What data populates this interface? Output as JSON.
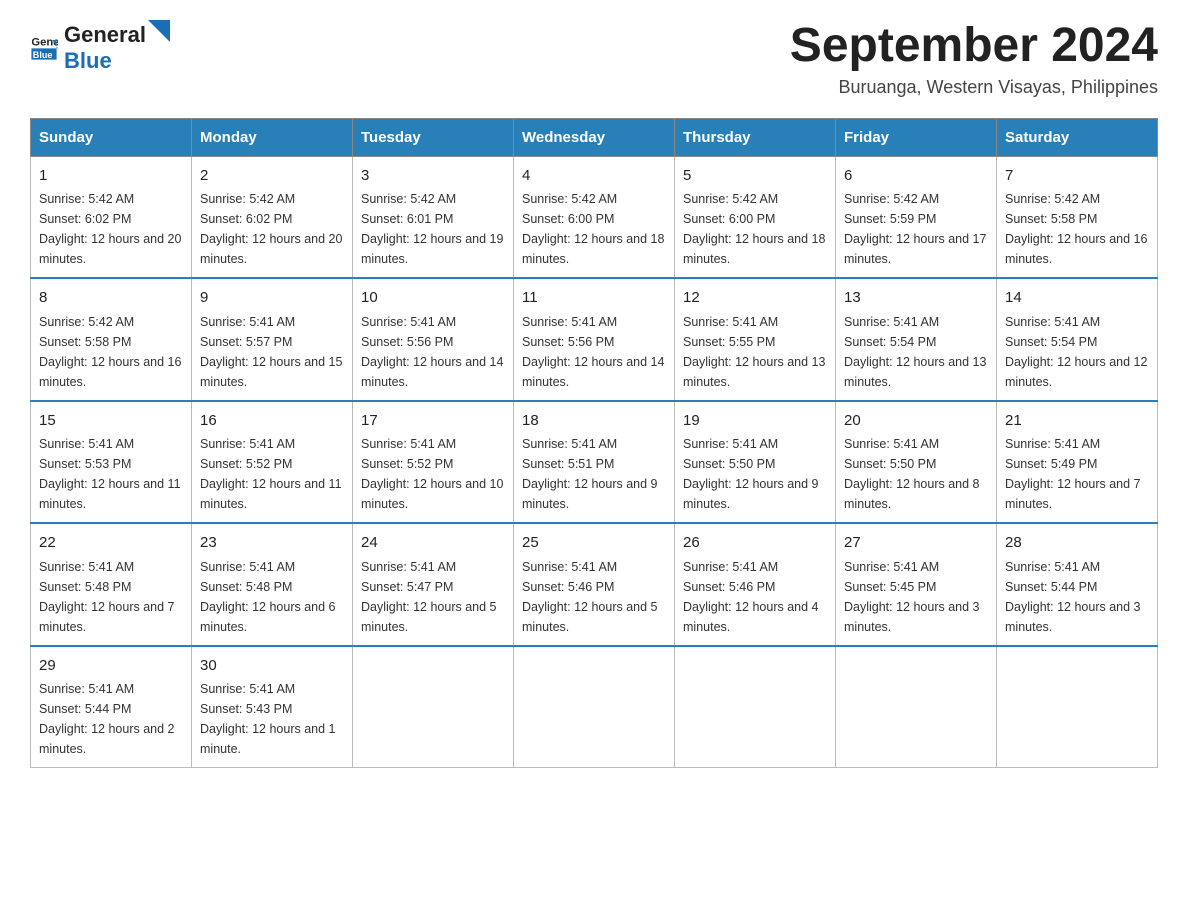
{
  "header": {
    "logo_general": "General",
    "logo_blue": "Blue",
    "title": "September 2024",
    "subtitle": "Buruanga, Western Visayas, Philippines"
  },
  "weekdays": [
    "Sunday",
    "Monday",
    "Tuesday",
    "Wednesday",
    "Thursday",
    "Friday",
    "Saturday"
  ],
  "weeks": [
    [
      {
        "day": "1",
        "sunrise": "5:42 AM",
        "sunset": "6:02 PM",
        "daylight": "12 hours and 20 minutes."
      },
      {
        "day": "2",
        "sunrise": "5:42 AM",
        "sunset": "6:02 PM",
        "daylight": "12 hours and 20 minutes."
      },
      {
        "day": "3",
        "sunrise": "5:42 AM",
        "sunset": "6:01 PM",
        "daylight": "12 hours and 19 minutes."
      },
      {
        "day": "4",
        "sunrise": "5:42 AM",
        "sunset": "6:00 PM",
        "daylight": "12 hours and 18 minutes."
      },
      {
        "day": "5",
        "sunrise": "5:42 AM",
        "sunset": "6:00 PM",
        "daylight": "12 hours and 18 minutes."
      },
      {
        "day": "6",
        "sunrise": "5:42 AM",
        "sunset": "5:59 PM",
        "daylight": "12 hours and 17 minutes."
      },
      {
        "day": "7",
        "sunrise": "5:42 AM",
        "sunset": "5:58 PM",
        "daylight": "12 hours and 16 minutes."
      }
    ],
    [
      {
        "day": "8",
        "sunrise": "5:42 AM",
        "sunset": "5:58 PM",
        "daylight": "12 hours and 16 minutes."
      },
      {
        "day": "9",
        "sunrise": "5:41 AM",
        "sunset": "5:57 PM",
        "daylight": "12 hours and 15 minutes."
      },
      {
        "day": "10",
        "sunrise": "5:41 AM",
        "sunset": "5:56 PM",
        "daylight": "12 hours and 14 minutes."
      },
      {
        "day": "11",
        "sunrise": "5:41 AM",
        "sunset": "5:56 PM",
        "daylight": "12 hours and 14 minutes."
      },
      {
        "day": "12",
        "sunrise": "5:41 AM",
        "sunset": "5:55 PM",
        "daylight": "12 hours and 13 minutes."
      },
      {
        "day": "13",
        "sunrise": "5:41 AM",
        "sunset": "5:54 PM",
        "daylight": "12 hours and 13 minutes."
      },
      {
        "day": "14",
        "sunrise": "5:41 AM",
        "sunset": "5:54 PM",
        "daylight": "12 hours and 12 minutes."
      }
    ],
    [
      {
        "day": "15",
        "sunrise": "5:41 AM",
        "sunset": "5:53 PM",
        "daylight": "12 hours and 11 minutes."
      },
      {
        "day": "16",
        "sunrise": "5:41 AM",
        "sunset": "5:52 PM",
        "daylight": "12 hours and 11 minutes."
      },
      {
        "day": "17",
        "sunrise": "5:41 AM",
        "sunset": "5:52 PM",
        "daylight": "12 hours and 10 minutes."
      },
      {
        "day": "18",
        "sunrise": "5:41 AM",
        "sunset": "5:51 PM",
        "daylight": "12 hours and 9 minutes."
      },
      {
        "day": "19",
        "sunrise": "5:41 AM",
        "sunset": "5:50 PM",
        "daylight": "12 hours and 9 minutes."
      },
      {
        "day": "20",
        "sunrise": "5:41 AM",
        "sunset": "5:50 PM",
        "daylight": "12 hours and 8 minutes."
      },
      {
        "day": "21",
        "sunrise": "5:41 AM",
        "sunset": "5:49 PM",
        "daylight": "12 hours and 7 minutes."
      }
    ],
    [
      {
        "day": "22",
        "sunrise": "5:41 AM",
        "sunset": "5:48 PM",
        "daylight": "12 hours and 7 minutes."
      },
      {
        "day": "23",
        "sunrise": "5:41 AM",
        "sunset": "5:48 PM",
        "daylight": "12 hours and 6 minutes."
      },
      {
        "day": "24",
        "sunrise": "5:41 AM",
        "sunset": "5:47 PM",
        "daylight": "12 hours and 5 minutes."
      },
      {
        "day": "25",
        "sunrise": "5:41 AM",
        "sunset": "5:46 PM",
        "daylight": "12 hours and 5 minutes."
      },
      {
        "day": "26",
        "sunrise": "5:41 AM",
        "sunset": "5:46 PM",
        "daylight": "12 hours and 4 minutes."
      },
      {
        "day": "27",
        "sunrise": "5:41 AM",
        "sunset": "5:45 PM",
        "daylight": "12 hours and 3 minutes."
      },
      {
        "day": "28",
        "sunrise": "5:41 AM",
        "sunset": "5:44 PM",
        "daylight": "12 hours and 3 minutes."
      }
    ],
    [
      {
        "day": "29",
        "sunrise": "5:41 AM",
        "sunset": "5:44 PM",
        "daylight": "12 hours and 2 minutes."
      },
      {
        "day": "30",
        "sunrise": "5:41 AM",
        "sunset": "5:43 PM",
        "daylight": "12 hours and 1 minute."
      },
      null,
      null,
      null,
      null,
      null
    ]
  ]
}
